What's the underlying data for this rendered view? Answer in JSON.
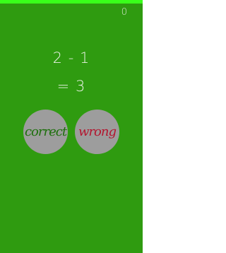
{
  "timer": {
    "remaining_fraction": 1.0,
    "color": "#39ff1a"
  },
  "score": "0",
  "equation": {
    "expression": "2 - 1",
    "result": "= 3"
  },
  "buttons": {
    "correct_label": "correct",
    "wrong_label": "wrong"
  },
  "colors": {
    "background": "#2f9b10",
    "button": "#9d9d9d",
    "correct_text": "#1d6f0c",
    "wrong_text": "#b3162f"
  }
}
